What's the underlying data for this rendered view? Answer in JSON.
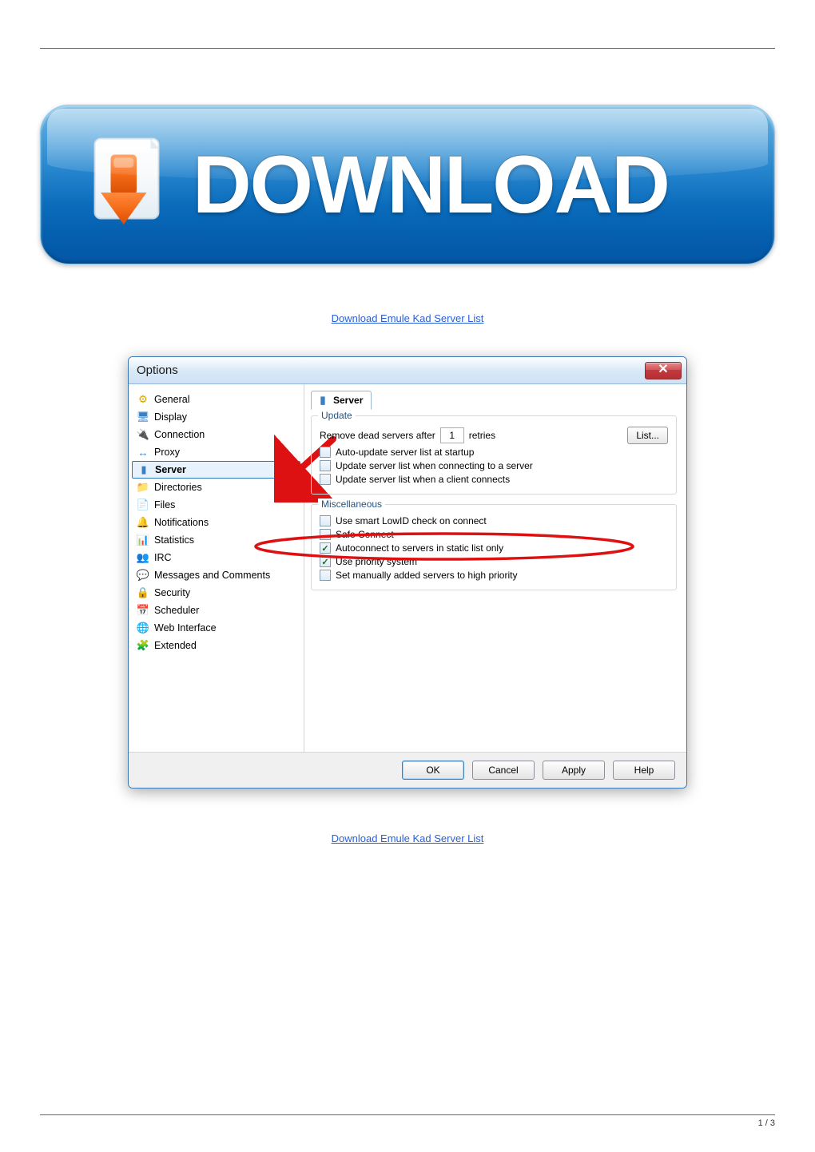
{
  "banner": {
    "text": "DOWNLOAD",
    "link_text": "Download Emule Kad Server List"
  },
  "dialog": {
    "title": "Options",
    "close_glyph": "✕",
    "sidebar": {
      "items": [
        {
          "id": "general",
          "label": "General",
          "icon": "⚙",
          "icon_color": "#d9a400"
        },
        {
          "id": "display",
          "label": "Display",
          "icon": "🖥",
          "icon_color": "#3a7fc4"
        },
        {
          "id": "connection",
          "label": "Connection",
          "icon": "🔌",
          "icon_color": "#d97a00"
        },
        {
          "id": "proxy",
          "label": "Proxy",
          "icon": "↔",
          "icon_color": "#3a7fc4"
        },
        {
          "id": "server",
          "label": "Server",
          "icon": "▮",
          "icon_color": "#3a7fc4",
          "selected": true
        },
        {
          "id": "directories",
          "label": "Directories",
          "icon": "📁",
          "icon_color": "#d9a400"
        },
        {
          "id": "files",
          "label": "Files",
          "icon": "📄",
          "icon_color": "#d9a400"
        },
        {
          "id": "notifications",
          "label": "Notifications",
          "icon": "🔔",
          "icon_color": "#c43a3a"
        },
        {
          "id": "statistics",
          "label": "Statistics",
          "icon": "📊",
          "icon_color": "#3a7fc4"
        },
        {
          "id": "irc",
          "label": "IRC",
          "icon": "👥",
          "icon_color": "#c43a3a"
        },
        {
          "id": "messages",
          "label": "Messages and Comments",
          "icon": "💬",
          "icon_color": "#d9a400"
        },
        {
          "id": "security",
          "label": "Security",
          "icon": "🔒",
          "icon_color": "#d9a400"
        },
        {
          "id": "scheduler",
          "label": "Scheduler",
          "icon": "📅",
          "icon_color": "#c43a3a"
        },
        {
          "id": "web",
          "label": "Web Interface",
          "icon": "🌐",
          "icon_color": "#2e9e3a"
        },
        {
          "id": "extended",
          "label": "Extended",
          "icon": "🧩",
          "icon_color": "#c43a3a"
        }
      ]
    },
    "tab": {
      "label": "Server"
    },
    "update_group": {
      "legend": "Update",
      "remove_label": "Remove dead servers after",
      "retries_value": "1",
      "retries_suffix": "retries",
      "list_button": "List...",
      "opts": [
        {
          "id": "auto_update",
          "label": "Auto-update server list at startup",
          "checked": false
        },
        {
          "id": "update_server",
          "label": "Update server list when connecting to a server",
          "checked": false
        },
        {
          "id": "update_client",
          "label": "Update server list when a client connects",
          "checked": false
        }
      ]
    },
    "misc_group": {
      "legend": "Miscellaneous",
      "opts": [
        {
          "id": "smart_lowid",
          "label": "Use smart LowID check on connect",
          "checked": false
        },
        {
          "id": "safe_connect",
          "label": "Safe Connect",
          "checked": false
        },
        {
          "id": "autoconnect",
          "label": "Autoconnect to servers in static list only",
          "checked": true
        },
        {
          "id": "priority_sys",
          "label": "Use priority system",
          "checked": true
        },
        {
          "id": "manual_high",
          "label": "Set manually added servers to high priority",
          "checked": false
        }
      ]
    },
    "buttons": {
      "ok": "OK",
      "cancel": "Cancel",
      "apply": "Apply",
      "help": "Help"
    }
  },
  "footer": {
    "page": "1 / 3"
  }
}
